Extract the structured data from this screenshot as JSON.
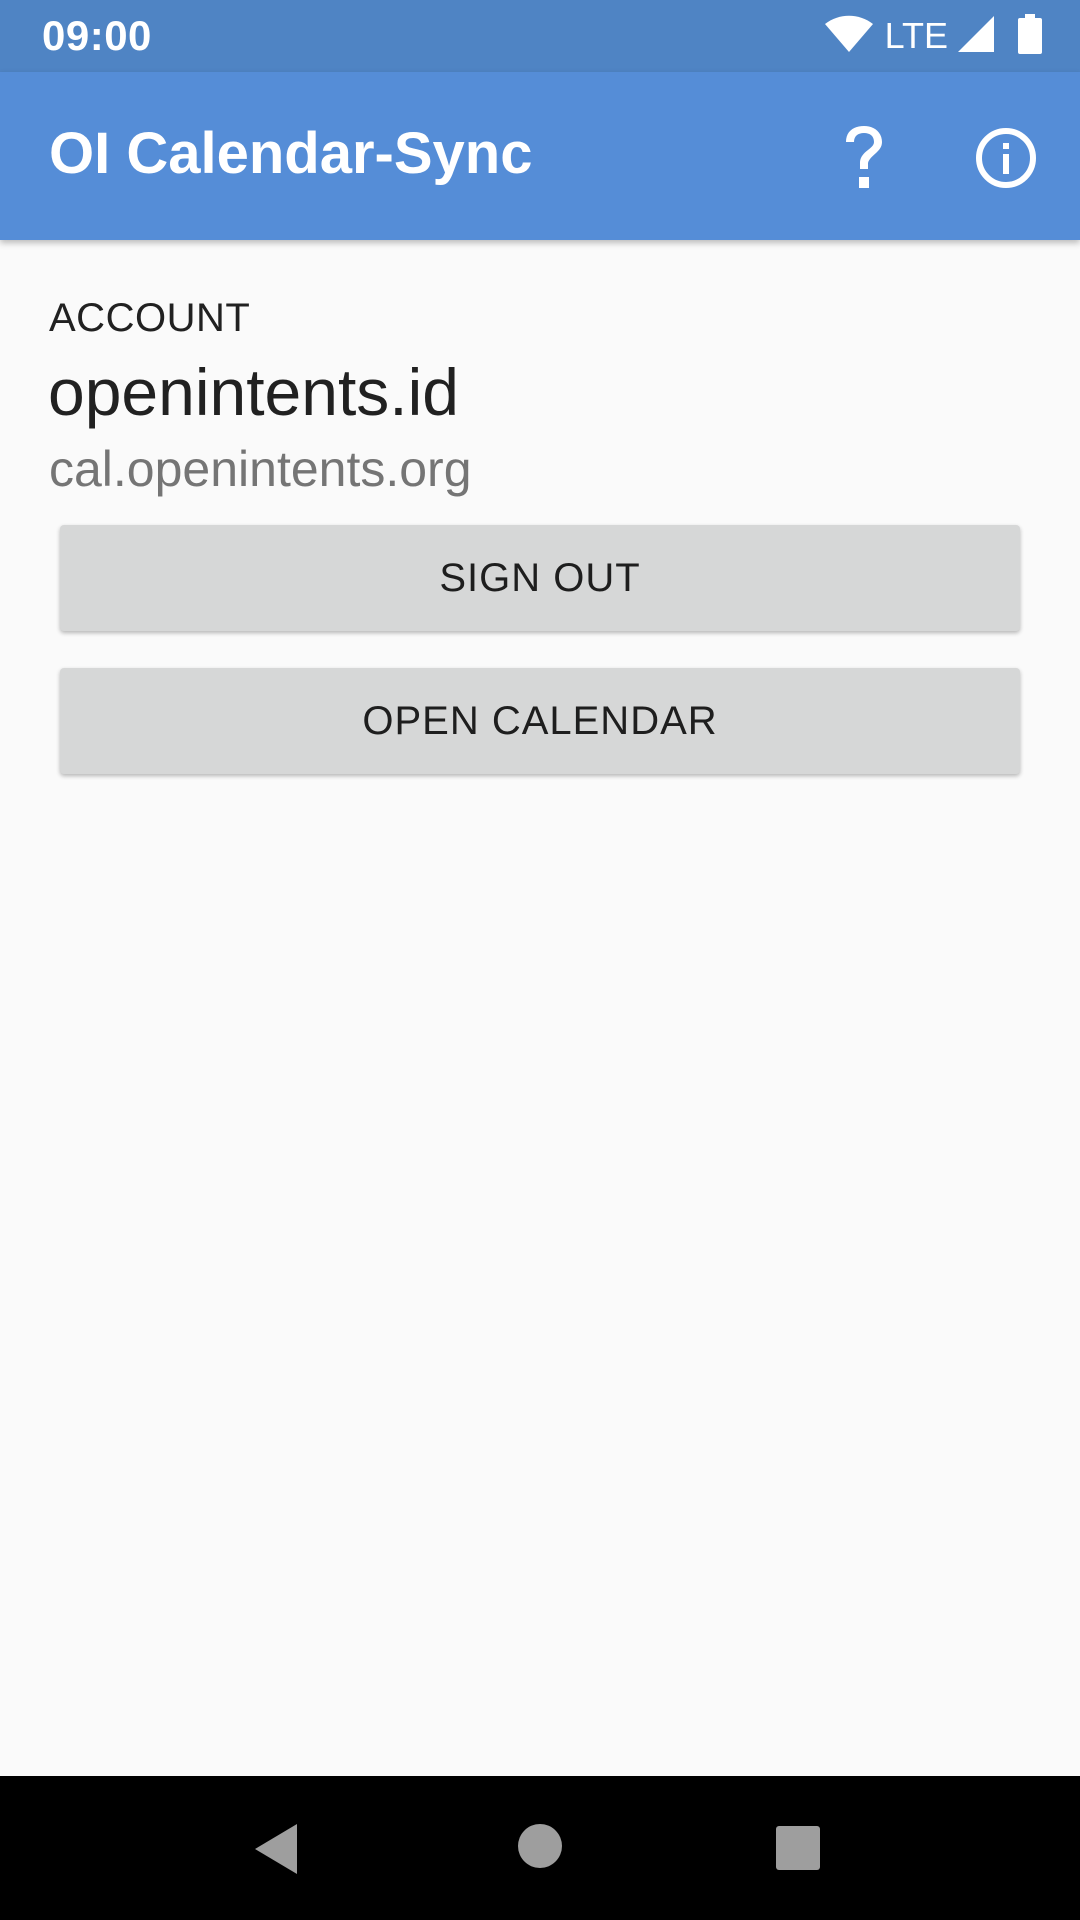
{
  "status_bar": {
    "time": "09:00",
    "network": "LTE",
    "icons": [
      "wifi-icon",
      "cell-signal-icon",
      "battery-icon"
    ]
  },
  "app_bar": {
    "title": "OI Calendar-Sync",
    "actions": [
      {
        "name": "help",
        "icon": "help-icon",
        "glyph": "?"
      },
      {
        "name": "about",
        "icon": "info-icon"
      }
    ],
    "color": "#558dd7"
  },
  "account": {
    "header": "ACCOUNT",
    "name": "openintents.id",
    "server": "cal.openintents.org"
  },
  "buttons": {
    "sign_out": "SIGN OUT",
    "open_calendar": "OPEN CALENDAR"
  },
  "nav_bar": {
    "icons": [
      "back-icon",
      "home-icon",
      "recent-apps-icon"
    ]
  }
}
